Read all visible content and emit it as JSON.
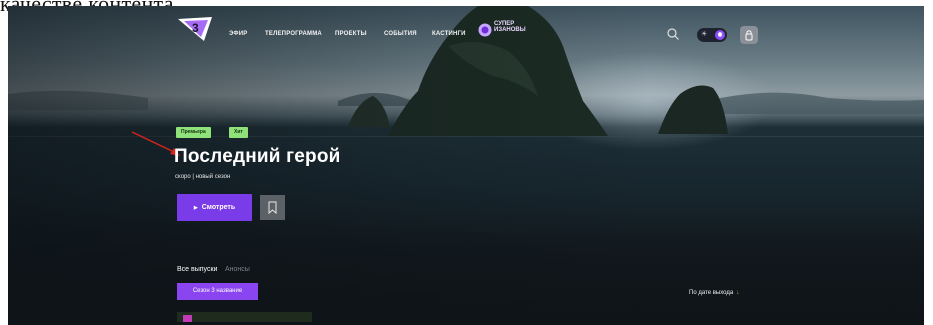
{
  "caption_fragment": "качестве контента",
  "nav": {
    "items": [
      "ЭФИР",
      "ТЕЛЕПРОГРАММА",
      "ПРОЕКТЫ",
      "СОБЫТИЯ",
      "КАСТИНГИ"
    ],
    "promo_label": "СУПЕР ИЗАНОВЫ"
  },
  "hero": {
    "tags": [
      "Премьера",
      "Хит"
    ],
    "title": "Последний герой",
    "subtitle": "скоро | новый сезон",
    "watch_label": "Смотреть"
  },
  "episodes": {
    "tabs": [
      "Все выпуски",
      "Анонсы"
    ],
    "season_label": "Сезон 3 название",
    "sort_label": "По дате выхода"
  },
  "colors": {
    "accent": "#7a3be8",
    "tag_green": "#8fe27a",
    "annotation_red": "#d9241b"
  }
}
